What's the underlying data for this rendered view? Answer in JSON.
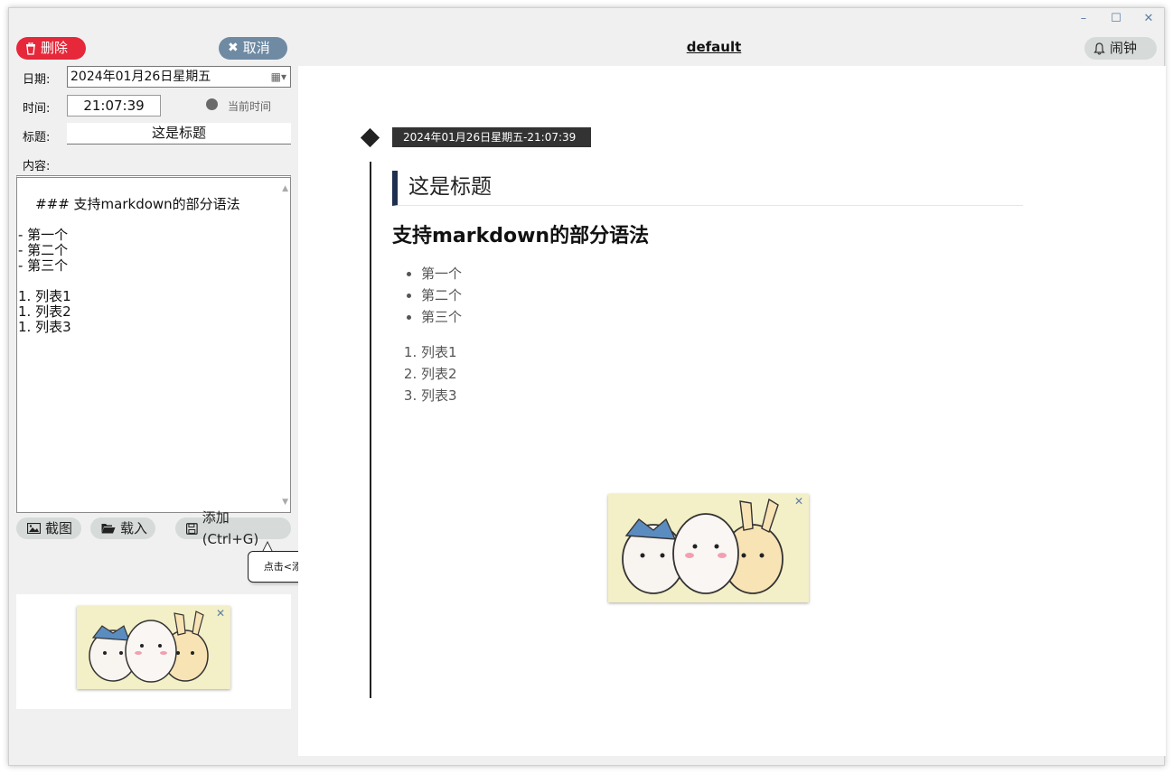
{
  "window": {
    "controls": {
      "minimize": "–",
      "maximize": "☐",
      "close": "✕"
    }
  },
  "toolbar": {
    "delete_label": "删除",
    "cancel_label": "取消",
    "alarm_label": "闹钟",
    "doc_title": "default"
  },
  "form": {
    "date_label": "日期:",
    "date_value": "2024年01月26日星期五",
    "time_label": "时间:",
    "time_value": "21:07:39",
    "current_time_label": "当前时间",
    "title_label": "标题:",
    "title_value": "这是标题",
    "content_label": "内容:",
    "content_value": "### 支持markdown的部分语法\n\n- 第一个\n- 第二个\n- 第三个\n\n1. 列表1\n1. 列表2\n1. 列表3"
  },
  "actions": {
    "screenshot_label": "截图",
    "load_label": "载入",
    "add_label": "添加(Ctrl+G)",
    "tooltip": "点击<添加>保存，否则不修改"
  },
  "preview": {
    "date_tag": "2024年01月26日星期五-21:07:39",
    "entry_title": "这是标题",
    "heading": "支持markdown的部分语法",
    "bullets": [
      "第一个",
      "第二个",
      "第三个"
    ],
    "numbered": [
      "列表1",
      "列表2",
      "列表3"
    ]
  },
  "ads": {
    "close_glyph": "✕"
  },
  "colors": {
    "delete_bg": "#e6283a",
    "cancel_bg": "#6f8aa3",
    "pill_bg": "#d6dad8",
    "title_accent": "#1f2f4f"
  }
}
